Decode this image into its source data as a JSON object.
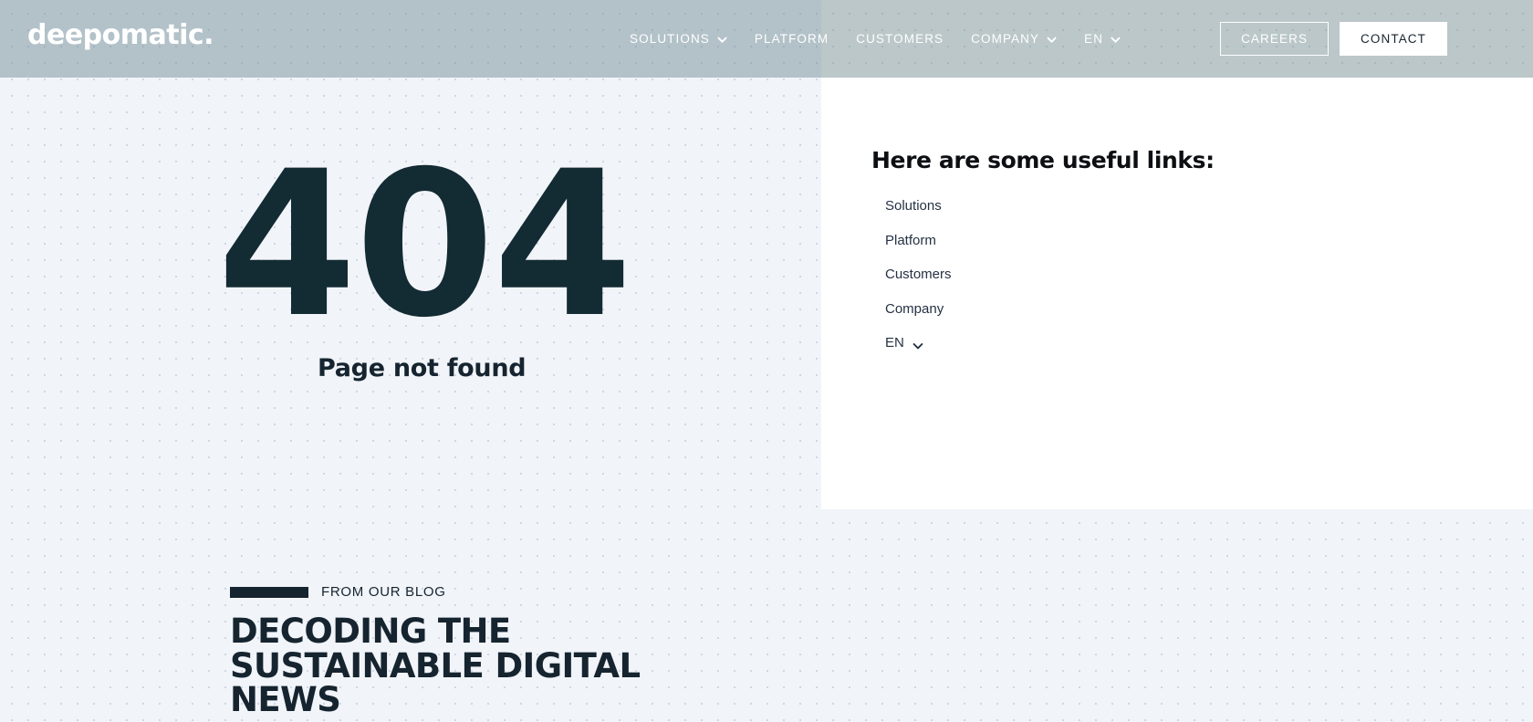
{
  "header": {
    "logo": "deepomatic.",
    "nav": [
      {
        "label": "SOLUTIONS",
        "has_chevron": true,
        "icon": "chevron-down-icon"
      },
      {
        "label": "PLATFORM",
        "has_chevron": false,
        "icon": ""
      },
      {
        "label": "CUSTOMERS",
        "has_chevron": false,
        "icon": ""
      },
      {
        "label": "COMPANY",
        "has_chevron": true,
        "icon": "chevron-down-icon"
      },
      {
        "label": "EN",
        "has_chevron": true,
        "icon": "chevron-down-icon"
      }
    ],
    "careers_label": "CAREERS",
    "contact_label": "CONTACT",
    "bg_color_left": "#b3c2c9",
    "bg_color_right": "#bbc7c9",
    "text_color": "#ffffff"
  },
  "error": {
    "code": "404",
    "message": "Page not found",
    "code_color": "#132b33"
  },
  "links_panel": {
    "title": "Here are some useful links:",
    "background": "#ffffff",
    "items": [
      {
        "label": "Solutions",
        "has_chevron": false,
        "icon": ""
      },
      {
        "label": "Platform",
        "has_chevron": false,
        "icon": ""
      },
      {
        "label": "Customers",
        "has_chevron": false,
        "icon": ""
      },
      {
        "label": "Company",
        "has_chevron": false,
        "icon": ""
      },
      {
        "label": "EN",
        "has_chevron": true,
        "icon": "chevron-down-icon"
      }
    ]
  },
  "blog": {
    "eyebrow": "FROM OUR BLOG",
    "title": "DECODING THE SUSTAINABLE DIGITAL NEWS",
    "accent_color": "#16242f"
  },
  "page": {
    "background": "#f1f4f9",
    "dot_color": "#c9d2e0"
  }
}
